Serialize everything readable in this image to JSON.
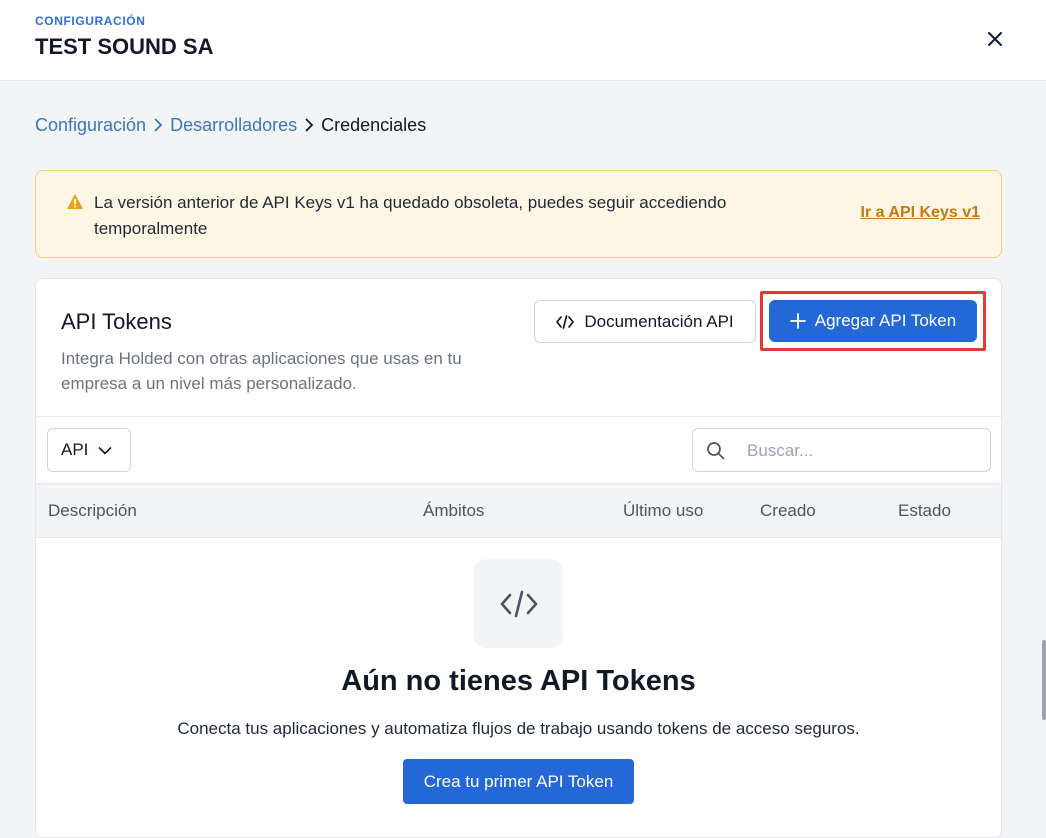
{
  "header": {
    "eyebrow": "CONFIGURACIÓN",
    "title": "TEST SOUND SA"
  },
  "breadcrumb": {
    "items": [
      "Configuración",
      "Desarrolladores"
    ],
    "current": "Credenciales"
  },
  "alert": {
    "message": "La versión anterior de API Keys v1 ha quedado obsoleta, puedes seguir accediendo temporalmente",
    "link": "Ir a API Keys v1"
  },
  "card": {
    "title": "API Tokens",
    "description": "Integra Holded con otras aplicaciones que usas en tu empresa a un nivel más personalizado.",
    "docs_button": "Documentación API",
    "add_button": "Agregar API Token",
    "filter": {
      "selected": "API"
    },
    "search": {
      "placeholder": "Buscar..."
    },
    "table": {
      "columns": [
        "Descripción",
        "Ámbitos",
        "Último uso",
        "Creado",
        "Estado"
      ]
    },
    "empty": {
      "title": "Aún no tienes API Tokens",
      "description": "Conecta tus aplicaciones y automatiza flujos de trabajo usando tokens de acceso seguros.",
      "button": "Crea tu primer API Token"
    }
  },
  "colors": {
    "primary": "#2468d8",
    "link": "#3b78b8",
    "warning": "#c47a10",
    "highlight": "#e5383b"
  }
}
